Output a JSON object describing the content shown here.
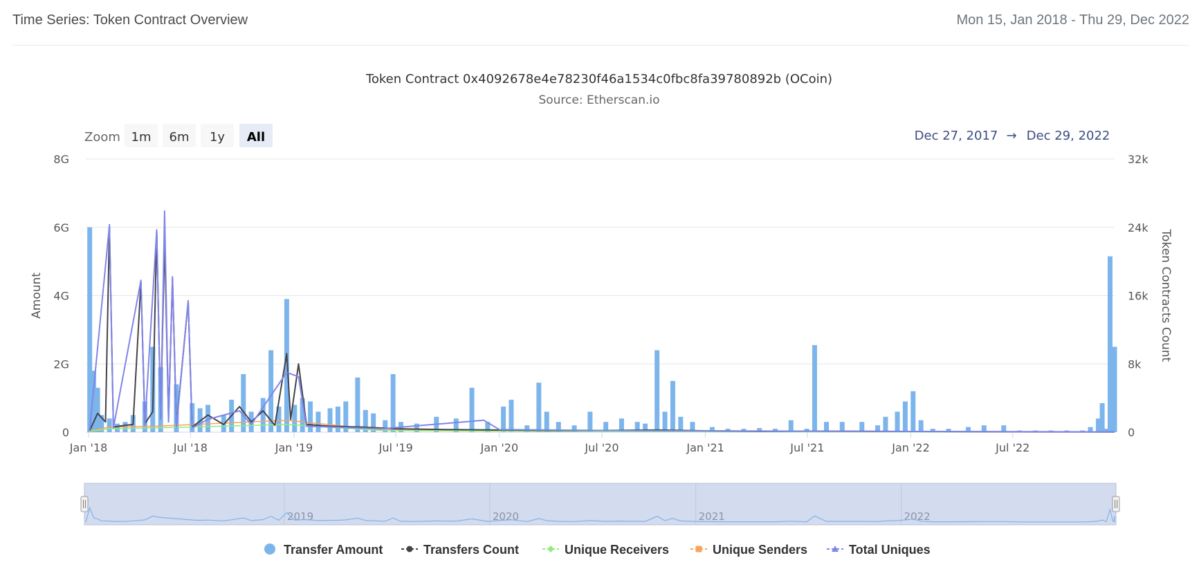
{
  "header": {
    "title": "Time Series: Token Contract Overview",
    "date_range": "Mon 15, Jan 2018 - Thu 29, Dec 2022"
  },
  "zoom": {
    "label": "Zoom",
    "buttons": [
      "1m",
      "6m",
      "1y",
      "All"
    ],
    "active": "All",
    "from": "Dec 27, 2017",
    "arrow": "→",
    "to": "Dec 29, 2022"
  },
  "colors": {
    "transfer_amount": "#7cb5ec",
    "transfers_count": "#434348",
    "unique_receivers": "#90ed7d",
    "unique_senders": "#f7a35c",
    "total_uniques": "#8085e9",
    "navigator_mask": "#d3dbee"
  },
  "chart_data": {
    "type": "bar",
    "title": "Token Contract 0x4092678e4e78230f46a1534c0fbc8fa39780892b (OCoin)",
    "subtitle": "Source: Etherscan.io",
    "xlabel": "",
    "ylabel": "Amount",
    "y2label": "Token Contracts Count",
    "x_ticks": [
      "Jan '18",
      "Jul '18",
      "Jan '19",
      "Jul '19",
      "Jan '20",
      "Jul '20",
      "Jan '21",
      "Jul '21",
      "Jan '22",
      "Jul '22"
    ],
    "y_ticks": [
      "0",
      "2G",
      "4G",
      "6G",
      "8G"
    ],
    "y2_ticks": [
      "0",
      "8k",
      "16k",
      "24k",
      "32k"
    ],
    "ylim": [
      0,
      8000000000
    ],
    "y2lim": [
      0,
      32000
    ],
    "xlim": [
      "2017-12-27",
      "2022-12-29"
    ],
    "grid": true,
    "legend_position": "bottom",
    "navigator_labels": [
      "2019",
      "2020",
      "2021",
      "2022"
    ],
    "series": [
      {
        "name": "Transfer Amount",
        "type": "column",
        "axis": "left",
        "points": [
          [
            "2018-01-03",
            6.0
          ],
          [
            "2018-01-10",
            1.8
          ],
          [
            "2018-01-17",
            1.3
          ],
          [
            "2018-01-24",
            0.5
          ],
          [
            "2018-02-07",
            0.4
          ],
          [
            "2018-02-21",
            0.25
          ],
          [
            "2018-03-07",
            0.3
          ],
          [
            "2018-03-21",
            0.5
          ],
          [
            "2018-04-11",
            0.9
          ],
          [
            "2018-04-25",
            2.5
          ],
          [
            "2018-05-09",
            1.9
          ],
          [
            "2018-06-06",
            1.4
          ],
          [
            "2018-07-04",
            0.85
          ],
          [
            "2018-07-18",
            0.7
          ],
          [
            "2018-08-01",
            0.8
          ],
          [
            "2018-08-29",
            0.5
          ],
          [
            "2018-09-12",
            0.95
          ],
          [
            "2018-10-03",
            1.7
          ],
          [
            "2018-10-17",
            0.6
          ],
          [
            "2018-11-07",
            1.0
          ],
          [
            "2018-11-21",
            2.4
          ],
          [
            "2018-12-05",
            0.75
          ],
          [
            "2018-12-19",
            3.9
          ],
          [
            "2019-01-02",
            0.8
          ],
          [
            "2019-01-16",
            1.0
          ],
          [
            "2019-01-30",
            0.9
          ],
          [
            "2019-02-13",
            0.6
          ],
          [
            "2019-03-06",
            0.7
          ],
          [
            "2019-03-20",
            0.75
          ],
          [
            "2019-04-03",
            0.9
          ],
          [
            "2019-04-24",
            1.6
          ],
          [
            "2019-05-08",
            0.65
          ],
          [
            "2019-05-22",
            0.55
          ],
          [
            "2019-06-12",
            0.35
          ],
          [
            "2019-06-26",
            1.7
          ],
          [
            "2019-07-10",
            0.3
          ],
          [
            "2019-08-07",
            0.25
          ],
          [
            "2019-09-11",
            0.45
          ],
          [
            "2019-10-16",
            0.4
          ],
          [
            "2019-11-13",
            1.3
          ],
          [
            "2019-12-11",
            0.3
          ],
          [
            "2020-01-08",
            0.75
          ],
          [
            "2020-01-22",
            0.95
          ],
          [
            "2020-02-19",
            0.2
          ],
          [
            "2020-03-11",
            1.45
          ],
          [
            "2020-03-25",
            0.6
          ],
          [
            "2020-04-15",
            0.3
          ],
          [
            "2020-05-13",
            0.2
          ],
          [
            "2020-06-10",
            0.6
          ],
          [
            "2020-07-08",
            0.3
          ],
          [
            "2020-08-05",
            0.4
          ],
          [
            "2020-09-02",
            0.3
          ],
          [
            "2020-09-16",
            0.25
          ],
          [
            "2020-10-07",
            2.4
          ],
          [
            "2020-10-21",
            0.6
          ],
          [
            "2020-11-04",
            1.5
          ],
          [
            "2020-11-18",
            0.45
          ],
          [
            "2020-12-09",
            0.3
          ],
          [
            "2021-01-13",
            0.15
          ],
          [
            "2021-02-10",
            0.1
          ],
          [
            "2021-03-10",
            0.1
          ],
          [
            "2021-04-07",
            0.12
          ],
          [
            "2021-05-05",
            0.1
          ],
          [
            "2021-06-02",
            0.35
          ],
          [
            "2021-06-30",
            0.1
          ],
          [
            "2021-07-14",
            2.55
          ],
          [
            "2021-08-04",
            0.3
          ],
          [
            "2021-09-01",
            0.3
          ],
          [
            "2021-10-06",
            0.3
          ],
          [
            "2021-11-03",
            0.2
          ],
          [
            "2021-11-17",
            0.45
          ],
          [
            "2021-12-08",
            0.6
          ],
          [
            "2021-12-22",
            0.9
          ],
          [
            "2022-01-05",
            1.2
          ],
          [
            "2022-01-19",
            0.35
          ],
          [
            "2022-02-09",
            0.1
          ],
          [
            "2022-03-09",
            0.1
          ],
          [
            "2022-04-13",
            0.15
          ],
          [
            "2022-05-11",
            0.2
          ],
          [
            "2022-06-15",
            0.2
          ],
          [
            "2022-07-13",
            0.05
          ],
          [
            "2022-08-10",
            0.05
          ],
          [
            "2022-09-07",
            0.05
          ],
          [
            "2022-10-05",
            0.05
          ],
          [
            "2022-11-02",
            0.05
          ],
          [
            "2022-11-16",
            0.15
          ],
          [
            "2022-11-30",
            0.4
          ],
          [
            "2022-12-07",
            0.85
          ],
          [
            "2022-12-14",
            0.1
          ],
          [
            "2022-12-21",
            5.15
          ],
          [
            "2022-12-26",
            0.25
          ],
          [
            "2022-12-27",
            0.35
          ],
          [
            "2022-12-28",
            0.55
          ],
          [
            "2022-12-29",
            2.5
          ]
        ]
      },
      {
        "name": "Transfers Count",
        "type": "line",
        "axis": "right",
        "points": [
          [
            "2018-01-03",
            200
          ],
          [
            "2018-01-17",
            2200
          ],
          [
            "2018-01-31",
            1200
          ],
          [
            "2018-02-07",
            24000
          ],
          [
            "2018-02-14",
            600
          ],
          [
            "2018-03-07",
            800
          ],
          [
            "2018-03-21",
            900
          ],
          [
            "2018-04-04",
            17600
          ],
          [
            "2018-04-11",
            1000
          ],
          [
            "2018-04-25",
            2400
          ],
          [
            "2018-05-02",
            23600
          ],
          [
            "2018-05-09",
            1800
          ],
          [
            "2018-05-16",
            22600
          ],
          [
            "2018-05-23",
            1600
          ],
          [
            "2018-05-30",
            18000
          ],
          [
            "2018-06-06",
            800
          ],
          [
            "2018-06-27",
            15300
          ],
          [
            "2018-07-04",
            600
          ],
          [
            "2018-08-01",
            2000
          ],
          [
            "2018-08-29",
            900
          ],
          [
            "2018-09-26",
            3000
          ],
          [
            "2018-10-17",
            1200
          ],
          [
            "2018-11-07",
            2500
          ],
          [
            "2018-11-28",
            800
          ],
          [
            "2018-12-19",
            9200
          ],
          [
            "2018-12-26",
            1500
          ],
          [
            "2019-01-09",
            8000
          ],
          [
            "2019-01-23",
            900
          ],
          [
            "2019-03-06",
            700
          ],
          [
            "2019-05-01",
            600
          ],
          [
            "2019-07-03",
            400
          ],
          [
            "2019-10-02",
            300
          ],
          [
            "2020-01-01",
            250
          ],
          [
            "2020-04-01",
            200
          ],
          [
            "2020-07-01",
            200
          ],
          [
            "2020-10-07",
            250
          ],
          [
            "2021-01-06",
            150
          ],
          [
            "2021-04-07",
            100
          ],
          [
            "2021-07-07",
            120
          ],
          [
            "2021-10-06",
            100
          ],
          [
            "2022-01-05",
            80
          ],
          [
            "2022-04-06",
            60
          ],
          [
            "2022-07-06",
            40
          ],
          [
            "2022-10-05",
            30
          ],
          [
            "2022-12-29",
            20
          ]
        ]
      },
      {
        "name": "Unique Receivers",
        "type": "line",
        "axis": "right",
        "points": [
          [
            "2018-01-03",
            100
          ],
          [
            "2018-02-07",
            400
          ],
          [
            "2018-05-02",
            500
          ],
          [
            "2018-12-19",
            900
          ],
          [
            "2019-06-05",
            200
          ],
          [
            "2020-01-01",
            120
          ],
          [
            "2021-01-06",
            60
          ],
          [
            "2022-01-05",
            30
          ],
          [
            "2022-12-29",
            10
          ]
        ]
      },
      {
        "name": "Unique Senders",
        "type": "line",
        "axis": "right",
        "points": [
          [
            "2018-01-03",
            150
          ],
          [
            "2018-02-07",
            600
          ],
          [
            "2018-05-02",
            700
          ],
          [
            "2018-12-19",
            1400
          ],
          [
            "2019-06-05",
            250
          ],
          [
            "2020-01-01",
            150
          ],
          [
            "2021-01-06",
            80
          ],
          [
            "2022-01-05",
            40
          ],
          [
            "2022-12-29",
            15
          ]
        ]
      },
      {
        "name": "Total Uniques",
        "type": "line",
        "axis": "right",
        "points": [
          [
            "2018-01-03",
            300
          ],
          [
            "2018-02-07",
            24300
          ],
          [
            "2018-02-14",
            500
          ],
          [
            "2018-04-04",
            17800
          ],
          [
            "2018-04-11",
            800
          ],
          [
            "2018-05-02",
            23700
          ],
          [
            "2018-05-09",
            1500
          ],
          [
            "2018-05-16",
            25900
          ],
          [
            "2018-05-23",
            1200
          ],
          [
            "2018-05-30",
            18200
          ],
          [
            "2018-06-06",
            600
          ],
          [
            "2018-06-27",
            15400
          ],
          [
            "2018-07-04",
            500
          ],
          [
            "2018-08-01",
            1500
          ],
          [
            "2018-09-26",
            2500
          ],
          [
            "2018-10-17",
            900
          ],
          [
            "2018-12-19",
            7000
          ],
          [
            "2019-01-09",
            6500
          ],
          [
            "2019-01-23",
            700
          ],
          [
            "2019-06-05",
            400
          ],
          [
            "2019-12-04",
            1400
          ],
          [
            "2020-01-01",
            300
          ],
          [
            "2020-07-01",
            200
          ],
          [
            "2021-01-06",
            150
          ],
          [
            "2022-01-05",
            80
          ],
          [
            "2022-12-29",
            30
          ]
        ]
      }
    ]
  },
  "legend": [
    {
      "label": "Transfer Amount",
      "color": "#7cb5ec",
      "marker": "circle"
    },
    {
      "label": "Transfers Count",
      "color": "#434348",
      "marker": "line-circle"
    },
    {
      "label": "Unique Receivers",
      "color": "#90ed7d",
      "marker": "line-diamond"
    },
    {
      "label": "Unique Senders",
      "color": "#f7a35c",
      "marker": "line-square"
    },
    {
      "label": "Total Uniques",
      "color": "#8085e9",
      "marker": "line-triangle"
    }
  ]
}
